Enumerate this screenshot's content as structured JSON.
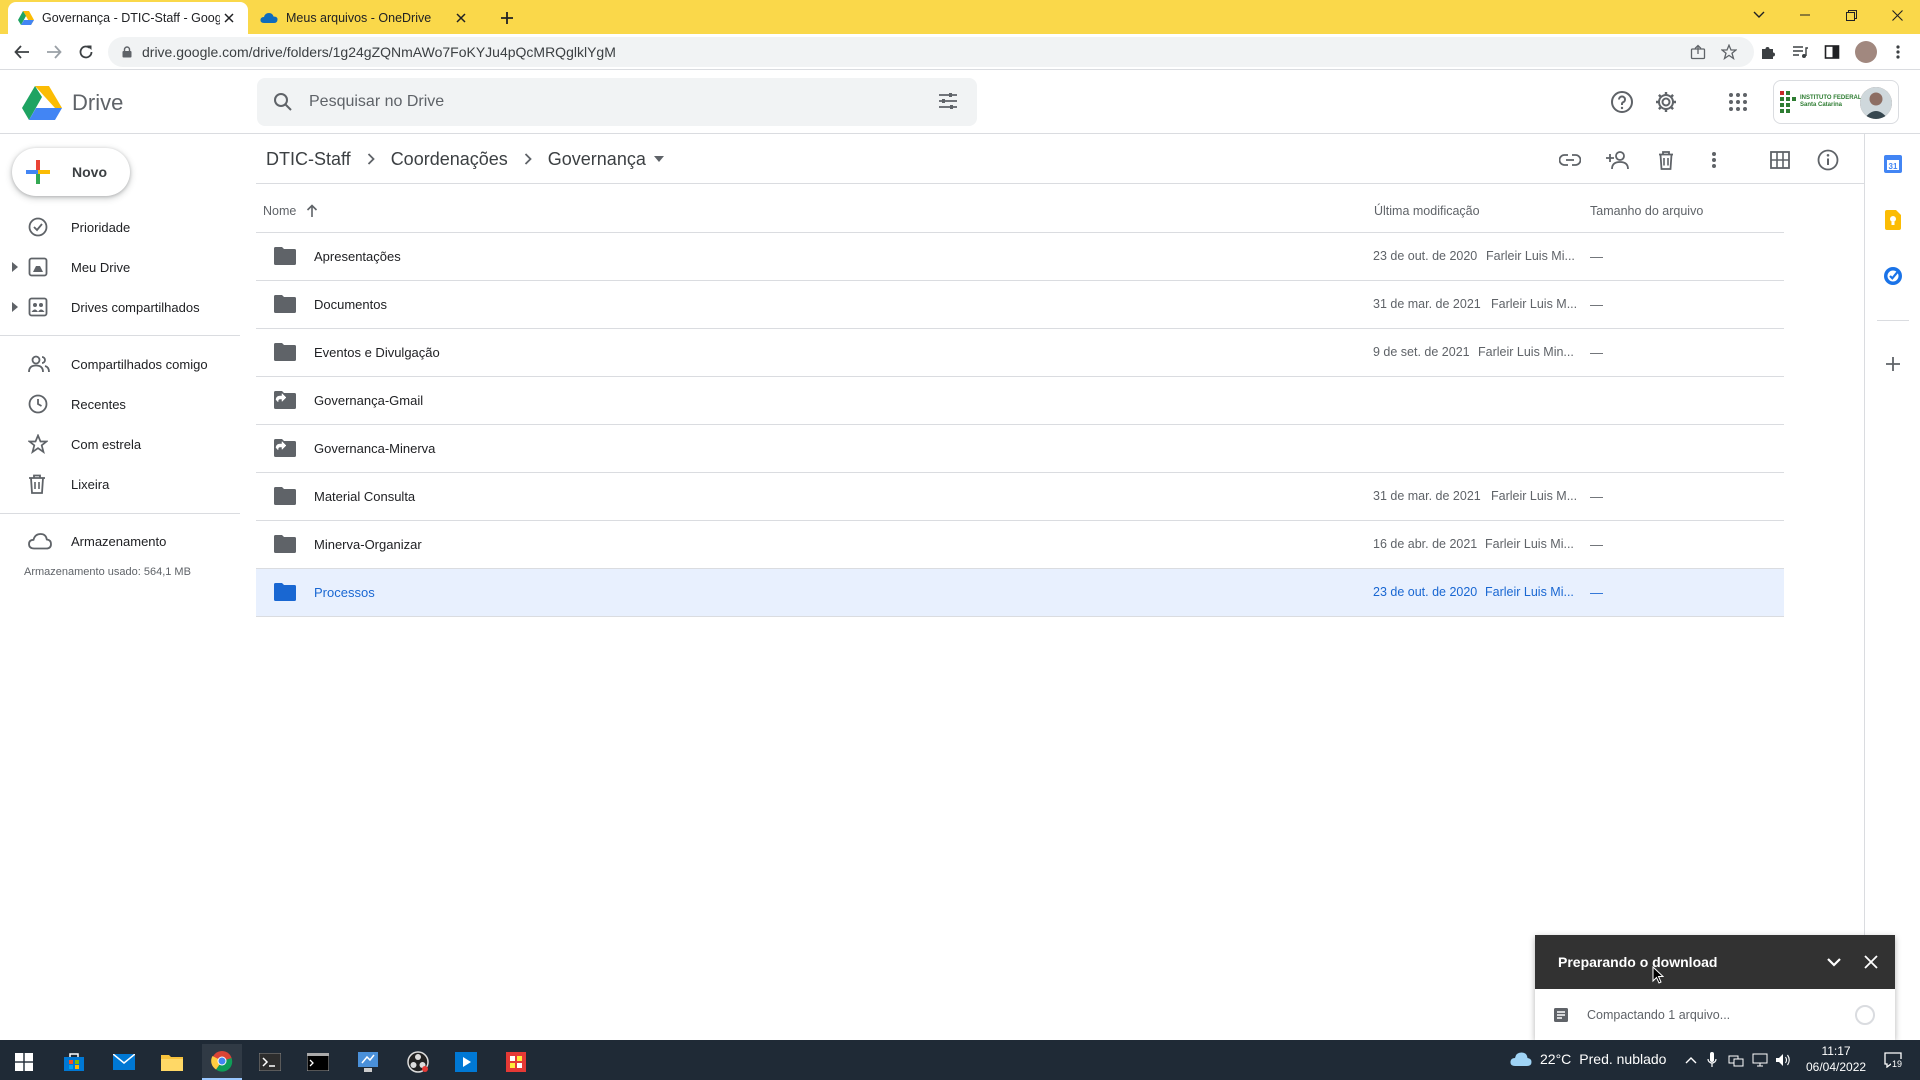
{
  "browser": {
    "tabs": [
      {
        "title": "Governança - DTIC-Staff - Googl",
        "active": true
      },
      {
        "title": "Meus arquivos - OneDrive",
        "active": false
      }
    ],
    "url": "drive.google.com/drive/folders/1g24gZQNmAWo7FoKYJu4pQcMRQglklYgM"
  },
  "header": {
    "app_name": "Drive",
    "search_placeholder": "Pesquisar no Drive",
    "org_name": "INSTITUTO FEDERAL Santa Catarina"
  },
  "sidebar": {
    "new_label": "Novo",
    "items": [
      {
        "label": "Prioridade",
        "icon": "priority-icon"
      },
      {
        "label": "Meu Drive",
        "icon": "my-drive-icon"
      },
      {
        "label": "Drives compartilhados",
        "icon": "shared-drives-icon"
      },
      {
        "label": "Compartilhados comigo",
        "icon": "shared-with-me-icon"
      },
      {
        "label": "Recentes",
        "icon": "clock-icon"
      },
      {
        "label": "Com estrela",
        "icon": "star-icon"
      },
      {
        "label": "Lixeira",
        "icon": "trash-icon"
      },
      {
        "label": "Armazenamento",
        "icon": "cloud-icon"
      }
    ],
    "storage_used": "Armazenamento usado: 564,1 MB"
  },
  "breadcrumb": [
    "DTIC-Staff",
    "Coordenações",
    "Governança"
  ],
  "columns": {
    "name": "Nome",
    "modified": "Última modificação",
    "size": "Tamanho do arquivo"
  },
  "files": [
    {
      "name": "Apresentações",
      "date": "23 de out. de 2020",
      "owner": "Farleir Luis Mi...",
      "size": "—",
      "shortcut": false
    },
    {
      "name": "Documentos",
      "date": "31 de mar. de 2021",
      "owner": "Farleir Luis M...",
      "size": "—",
      "shortcut": false
    },
    {
      "name": "Eventos e Divulgação",
      "date": "9 de set. de 2021",
      "owner": "Farleir Luis Min...",
      "size": "—",
      "shortcut": false
    },
    {
      "name": "Governança-Gmail",
      "date": "",
      "owner": "",
      "size": "",
      "shortcut": true
    },
    {
      "name": "Governanca-Minerva",
      "date": "",
      "owner": "",
      "size": "",
      "shortcut": true
    },
    {
      "name": "Material Consulta",
      "date": "31 de mar. de 2021",
      "owner": "Farleir Luis M...",
      "size": "—",
      "shortcut": false
    },
    {
      "name": "Minerva-Organizar",
      "date": "16 de abr. de 2021",
      "owner": "Farleir Luis Mi...",
      "size": "—",
      "shortcut": false
    },
    {
      "name": "Processos",
      "date": "23 de out. de 2020",
      "owner": "Farleir Luis Mi...",
      "size": "—",
      "shortcut": false,
      "selected": true
    }
  ],
  "download_popup": {
    "title": "Preparando o download",
    "status": "Compactando 1 arquivo..."
  },
  "taskbar": {
    "weather_temp": "22°C",
    "weather_desc": "Pred. nublado",
    "time": "11:17",
    "date": "06/04/2022",
    "notifications": "19"
  },
  "colors": {
    "tab_bar": "#fad84a",
    "selected_row": "#e8f0fe",
    "selected_text": "#1967d2"
  }
}
